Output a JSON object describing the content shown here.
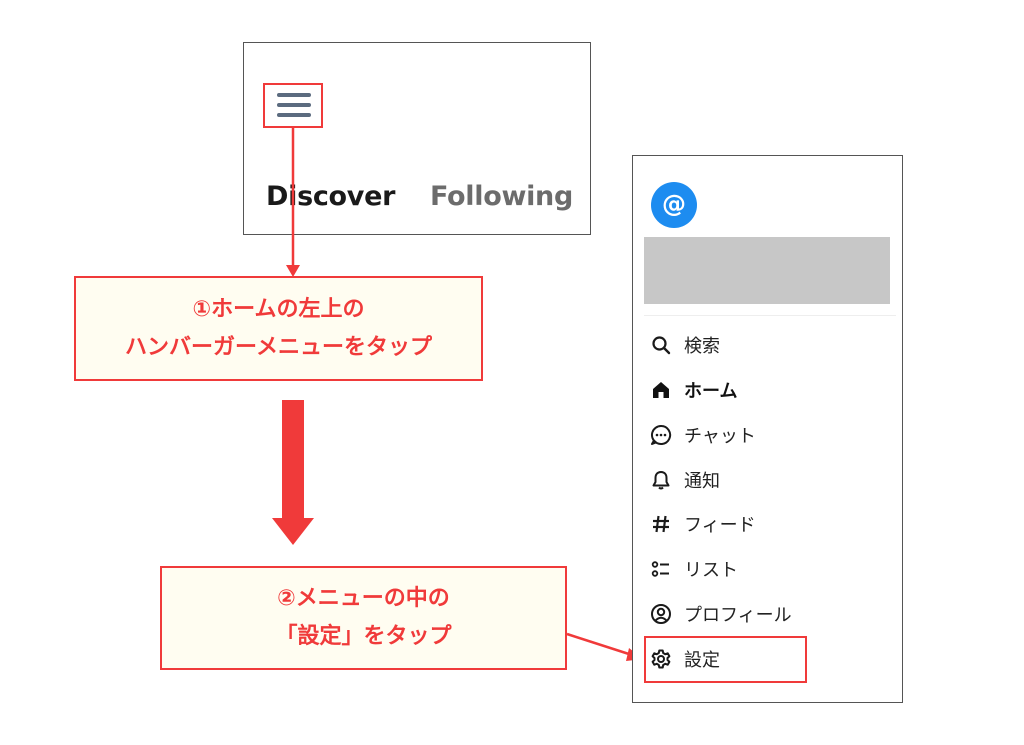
{
  "app_header": {
    "tabs": [
      {
        "label": "Discover"
      },
      {
        "label": "Following"
      }
    ]
  },
  "callouts": {
    "step1": {
      "line1": "①ホームの左上の",
      "line2": "ハンバーガーメニューをタップ"
    },
    "step2": {
      "line1": "②メニューの中の",
      "line2": "「設定」をタップ"
    }
  },
  "menu": {
    "avatar_symbol": "@",
    "items": [
      {
        "label": "検索",
        "icon": "search-icon"
      },
      {
        "label": "ホーム",
        "icon": "home-icon",
        "active": true
      },
      {
        "label": "チャット",
        "icon": "chat-icon"
      },
      {
        "label": "通知",
        "icon": "bell-icon"
      },
      {
        "label": "フィード",
        "icon": "hash-icon"
      },
      {
        "label": "リスト",
        "icon": "list-icon"
      },
      {
        "label": "プロフィール",
        "icon": "profile-icon"
      },
      {
        "label": "設定",
        "icon": "gear-icon"
      }
    ]
  },
  "colors": {
    "accent_red": "#f03a3a",
    "avatar_blue": "#1d8cf0",
    "callout_bg": "#fffdf1"
  }
}
